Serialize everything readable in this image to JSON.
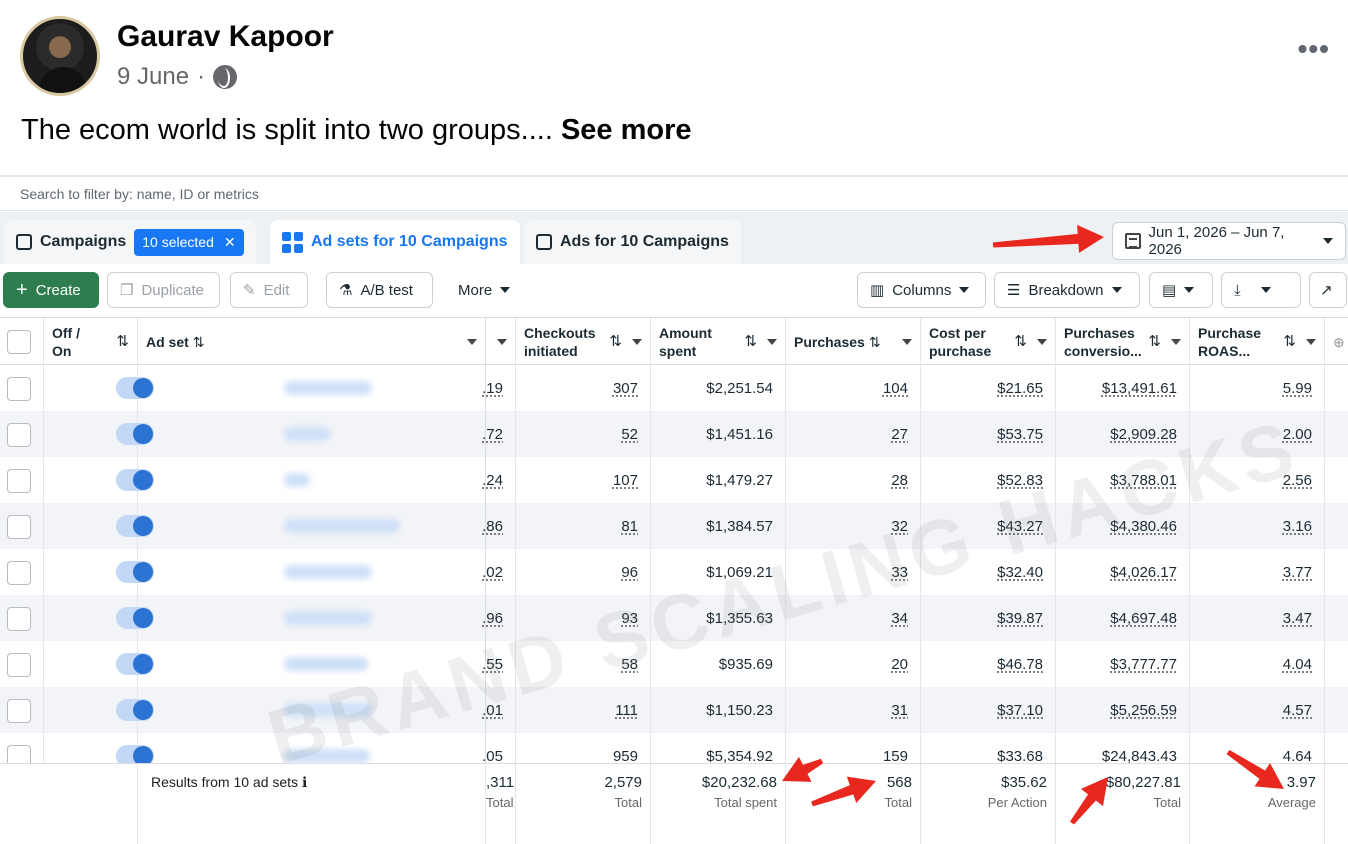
{
  "post": {
    "author": "Gaurav Kapoor",
    "date": "9 June",
    "separator": "·",
    "text": "The ecom world is split into two groups....",
    "see_more": "See more",
    "more_dots": "•••"
  },
  "ads_manager": {
    "filter_placeholder": "Search to filter by: name, ID or metrics",
    "tabs": {
      "campaigns": "Campaigns",
      "selected_pill": "10 selected",
      "adsets": "Ad sets for 10 Campaigns",
      "ads": "Ads for 10 Campaigns"
    },
    "date_range": "Jun 1, 2026 – Jun 7, 2026",
    "toolbar": {
      "create": "Create",
      "duplicate": "Duplicate",
      "edit": "Edit",
      "ab_test": "A/B test",
      "more": "More",
      "columns": "Columns",
      "breakdown": "Breakdown"
    },
    "headers": {
      "off_on": "Off / On",
      "ad_set": "Ad set",
      "checkouts": "Checkouts initiated",
      "amount": "Amount spent",
      "purchases": "Purchases",
      "cpp": "Cost per purchase",
      "conv": "Purchases conversio...",
      "roas": "Purchase ROAS..."
    },
    "rows": [
      {
        "prev": ".19",
        "checkouts": "307",
        "amount": "$2,251.54",
        "purchases": "104",
        "cpp": "$21.65",
        "conv": "$13,491.61",
        "roas": "5.99"
      },
      {
        "prev": ".72",
        "checkouts": "52",
        "amount": "$1,451.16",
        "purchases": "27",
        "cpp": "$53.75",
        "conv": "$2,909.28",
        "roas": "2.00"
      },
      {
        "prev": ".24",
        "checkouts": "107",
        "amount": "$1,479.27",
        "purchases": "28",
        "cpp": "$52.83",
        "conv": "$3,788.01",
        "roas": "2.56"
      },
      {
        "prev": ".86",
        "checkouts": "81",
        "amount": "$1,384.57",
        "purchases": "32",
        "cpp": "$43.27",
        "conv": "$4,380.46",
        "roas": "3.16"
      },
      {
        "prev": ".02",
        "checkouts": "96",
        "amount": "$1,069.21",
        "purchases": "33",
        "cpp": "$32.40",
        "conv": "$4,026.17",
        "roas": "3.77"
      },
      {
        "prev": ".96",
        "checkouts": "93",
        "amount": "$1,355.63",
        "purchases": "34",
        "cpp": "$39.87",
        "conv": "$4,697.48",
        "roas": "3.47"
      },
      {
        "prev": ".55",
        "checkouts": "58",
        "amount": "$935.69",
        "purchases": "20",
        "cpp": "$46.78",
        "conv": "$3,777.77",
        "roas": "4.04"
      },
      {
        "prev": ".01",
        "checkouts": "111",
        "amount": "$1,150.23",
        "purchases": "31",
        "cpp": "$37.10",
        "conv": "$5,256.59",
        "roas": "4.57"
      },
      {
        "prev": ".05",
        "checkouts": "959",
        "amount": "$5,354.92",
        "purchases": "159",
        "cpp": "$33.68",
        "conv": "$24,843.43",
        "roas": "4.64"
      }
    ],
    "footer": {
      "label": "Results from 10 ad sets",
      "info_icon": "ℹ",
      "prev": ",311",
      "prev_label": "Total",
      "checkouts": "2,579",
      "checkouts_label": "Total",
      "amount": "$20,232.68",
      "amount_label": "Total spent",
      "purchases": "568",
      "purchases_label": "Total",
      "cpp": "$35.62",
      "cpp_label": "Per Action",
      "conv": "$80,227.81",
      "conv_label": "Total",
      "roas": "3.97",
      "roas_label": "Average"
    },
    "watermark": "BRAND SCALING HACKS",
    "annotation_color": "#e8281e"
  }
}
